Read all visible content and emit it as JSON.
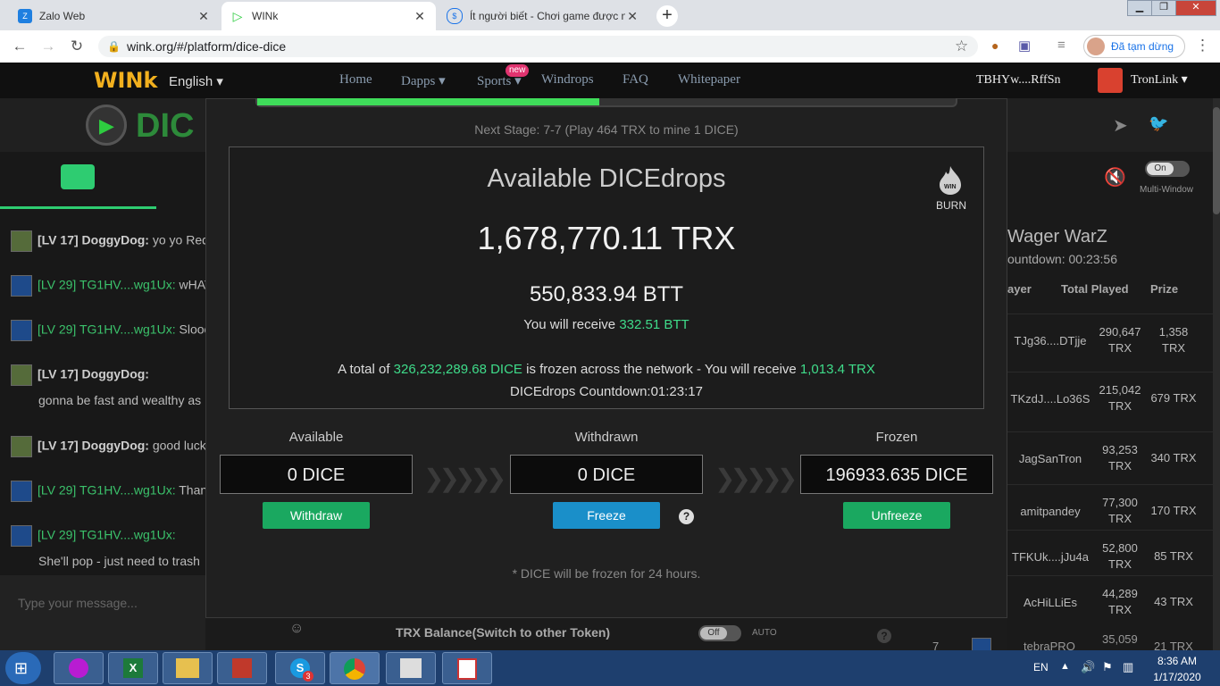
{
  "browser": {
    "tabs": [
      {
        "title": "Zalo Web",
        "favicon": "Zalo",
        "active": false
      },
      {
        "title": "WINk",
        "favicon": "play",
        "active": true
      },
      {
        "title": "Ít người biết - Chơi game được n",
        "favicon": "S",
        "active": false
      }
    ],
    "url": "wink.org/#/platform/dice-dice",
    "profile_status": "Đã tạm dừng"
  },
  "site": {
    "language": "English ▾",
    "nav": [
      "Home",
      "Dapps ▾",
      "Sports ▾",
      "Windrops",
      "FAQ",
      "Whitepaper"
    ],
    "new_badge": "new",
    "account": "TBHYw....RffSn",
    "wallet": "TronLink ▾",
    "logo_text": "DIC"
  },
  "chat": {
    "messages": [
      {
        "name": "[LV 17] DoggyDog:",
        "text": "yo yo Red-B",
        "color": "white"
      },
      {
        "name": "[LV 29] TG1HV....wg1Ux:",
        "text": "wHAT",
        "color": "green"
      },
      {
        "name": "[LV 29] TG1HV....wg1Ux:",
        "text": "Slooo",
        "color": "green"
      },
      {
        "name": "[LV 17] DoggyDog:",
        "text": "",
        "color": "white"
      },
      {
        "name": "",
        "text": "gonna be fast and wealthy as",
        "color": "plain"
      },
      {
        "name": "[LV 17] DoggyDog:",
        "text": "good luck",
        "color": "white"
      },
      {
        "name": "[LV 29] TG1HV....wg1Ux:",
        "text": "Than",
        "color": "green"
      },
      {
        "name": "[LV 29] TG1HV....wg1Ux:",
        "text": "",
        "color": "green"
      },
      {
        "name": "",
        "text": "She'll pop - just need to trash",
        "color": "plain"
      }
    ],
    "input_placeholder": "Type your message..."
  },
  "modal": {
    "next_stage": "Next Stage: 7-7 (Play 464 TRX to mine 1 DICE)",
    "title": "Available DICEdrops",
    "burn_label": "BURN",
    "burn_badge": "WIN",
    "trx_amount": "1,678,770.11 TRX",
    "btt_amount": "550,833.94 BTT",
    "receive_prefix": "You will receive",
    "receive_btt": "332.51 BTT",
    "total_prefix": "A total of",
    "total_dice": "326,232,289.68 DICE",
    "total_mid": "is frozen across the network - You will receive",
    "total_trx": "1,013.4 TRX",
    "countdown": "DICEdrops Countdown:01:23:17",
    "available_label": "Available",
    "available_value": "0 DICE",
    "withdraw_btn": "Withdraw",
    "withdrawn_label": "Withdrawn",
    "withdrawn_value": "0 DICE",
    "freeze_btn": "Freeze",
    "frozen_label": "Frozen",
    "frozen_value": "196933.635 DICE",
    "unfreeze_btn": "Unfreeze",
    "note": "* DICE will be frozen for 24 hours."
  },
  "under_modal": {
    "balance_label": "TRX Balance(Switch to other Token)",
    "off_toggle": "Off",
    "auto_label": "AUTO",
    "on_toggle": "On",
    "multiwindow": "Multi-Window"
  },
  "wager": {
    "title": "Wager WarZ",
    "countdown": "ountdown: 00:23:56",
    "headers": [
      "ayer",
      "Total Played",
      "Prize"
    ],
    "rows": [
      {
        "player": "TJg36....DTjje",
        "total": "290,647 TRX",
        "prize": "1,358 TRX"
      },
      {
        "player": "TKzdJ....Lo36S",
        "total": "215,042 TRX",
        "prize": "679 TRX"
      },
      {
        "player": "JagSanTron",
        "total": "93,253 TRX",
        "prize": "340 TRX"
      },
      {
        "player": "amitpandey",
        "total": "77,300 TRX",
        "prize": "170 TRX"
      },
      {
        "player": "TFKUk....jJu4a",
        "total": "52,800 TRX",
        "prize": "85 TRX"
      },
      {
        "player": "AcHiLLiEs",
        "total": "44,289 TRX",
        "prize": "43 TRX"
      },
      {
        "player": "tebraPRO",
        "total": "35,059",
        "prize": "21 TRX",
        "rank": "7"
      }
    ]
  },
  "taskbar": {
    "lang": "EN",
    "time": "8:36 AM",
    "date": "1/17/2020",
    "skype_badge": "3"
  },
  "colors": {
    "accent_green": "#3fdc8a",
    "button_green": "#1aa860",
    "button_blue": "#1a8fc9",
    "chat_green": "#3bc26b"
  }
}
